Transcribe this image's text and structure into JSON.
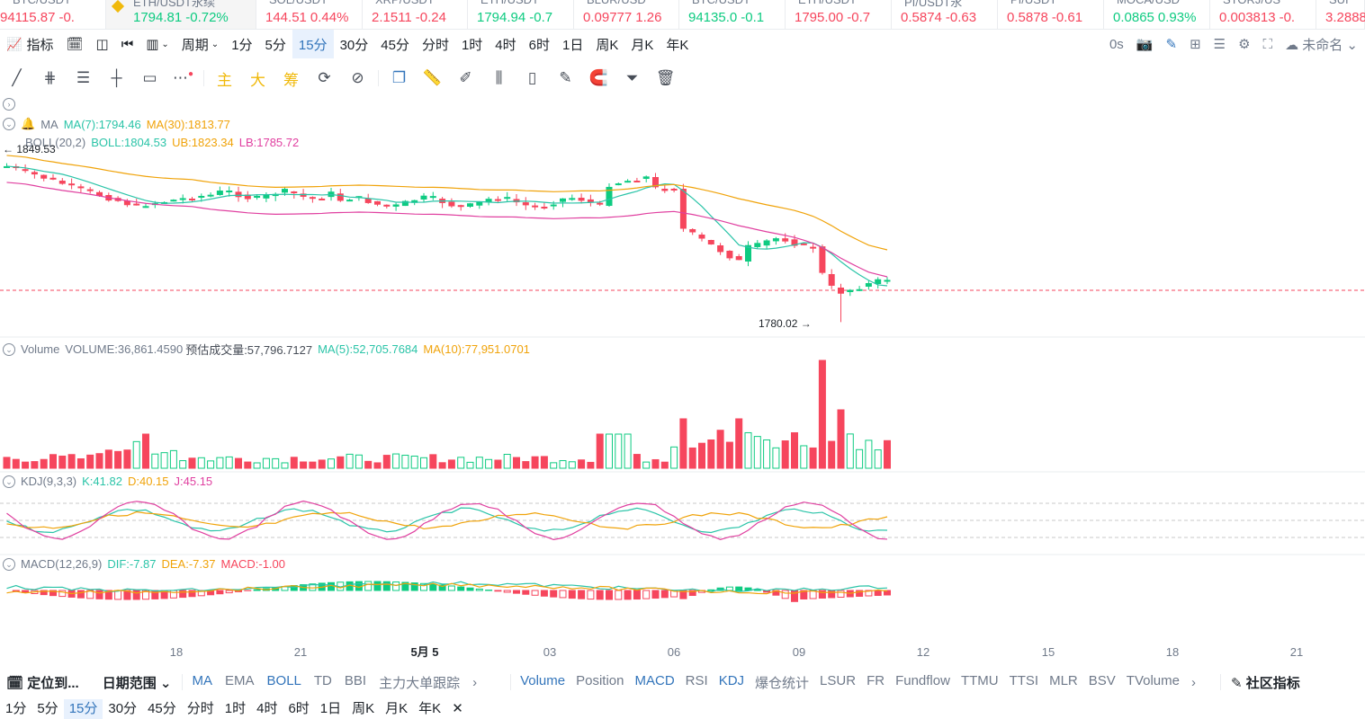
{
  "tickers": [
    {
      "symbol": "BTC/USDT",
      "price": "94115.87",
      "change": "-0.",
      "dir": "down",
      "active": false
    },
    {
      "symbol": "ETH/USDT永续",
      "price": "1794.81",
      "change": "-0.72%",
      "dir": "up",
      "active": true
    },
    {
      "symbol": "SOL/USDT",
      "price": "144.51",
      "change": "0.44%",
      "dir": "down",
      "active": false
    },
    {
      "symbol": "XRP/USDT",
      "price": "2.1511",
      "change": "-0.24",
      "dir": "down",
      "active": false
    },
    {
      "symbol": "ETH/USDT",
      "price": "1794.94",
      "change": "-0.7",
      "dir": "up",
      "active": false
    },
    {
      "symbol": "BLUR/USD",
      "price": "0.09777",
      "change": "1.26",
      "dir": "down",
      "active": false
    },
    {
      "symbol": "BTC/USDT",
      "price": "94135.0",
      "change": "-0.1",
      "dir": "up",
      "active": false
    },
    {
      "symbol": "ETH/USDT",
      "price": "1795.00",
      "change": "-0.7",
      "dir": "down",
      "active": false
    },
    {
      "symbol": "PI/USDT永",
      "price": "0.5874",
      "change": "-0.63",
      "dir": "down",
      "active": false
    },
    {
      "symbol": "PI/USDT",
      "price": "0.5878",
      "change": "-0.61",
      "dir": "down",
      "active": false
    },
    {
      "symbol": "MOCA/USD",
      "price": "0.0865",
      "change": "0.93%",
      "dir": "up",
      "active": false
    },
    {
      "symbol": "STORJ/US",
      "price": "0.003813",
      "change": "-0.",
      "dir": "down",
      "active": false
    },
    {
      "symbol": "SUI",
      "price": "3.2888",
      "change": "",
      "dir": "down",
      "active": false
    }
  ],
  "toolbar": {
    "indicator": "指标",
    "period": "周期",
    "intervals": [
      "1分",
      "5分",
      "15分",
      "30分",
      "45分",
      "分时",
      "1时",
      "4时",
      "6时",
      "1日",
      "周K",
      "月K",
      "年K"
    ],
    "active_interval": "15分",
    "countdown": "0s",
    "layout_name": "未命名"
  },
  "drawing_tools": {
    "main": "主",
    "big": "大",
    "chip": "筹"
  },
  "colors": {
    "up": "#0ecb81",
    "down": "#f6465d",
    "accent": "#3375bb",
    "ma7": "#2bc4a8",
    "ma30": "#f0a30a",
    "boll": "#e040a0",
    "lb": "#e040a0"
  },
  "ma_legend": {
    "name": "MA",
    "ma7": "MA(7):1794.46",
    "ma30": "MA(30):1813.77"
  },
  "boll_legend": {
    "name": "BOLL(20,2)",
    "boll": "BOLL:1804.53",
    "ub": "UB:1823.34",
    "lb": "LB:1785.72"
  },
  "high_marker": "1849.53",
  "low_marker": "1780.02",
  "volume_legend": {
    "name": "Volume",
    "volume": "VOLUME:36,861.4590",
    "est": "预估成交量:57,796.7127",
    "ma5": "MA(5):52,705.7684",
    "ma10": "MA(10):77,951.0701"
  },
  "kdj_legend": {
    "name": "KDJ(9,3,3)",
    "k": "K:41.82",
    "d": "D:40.15",
    "j": "J:45.15"
  },
  "macd_legend": {
    "name": "MACD(12,26,9)",
    "dif": "DIF:-7.87",
    "dea": "DEA:-7.37",
    "macd": "MACD:-1.00"
  },
  "x_axis": [
    "18",
    "21",
    "5月 5",
    "03",
    "06",
    "09",
    "12",
    "15",
    "18",
    "21"
  ],
  "bottom_bar": {
    "locate": "定位到...",
    "date_range": "日期范围",
    "main_indicators": [
      "MA",
      "EMA",
      "BOLL",
      "TD",
      "BBI",
      "主力大单跟踪"
    ],
    "sub_indicators": [
      "Volume",
      "Position",
      "MACD",
      "RSI",
      "KDJ",
      "爆仓统计",
      "LSUR",
      "FR",
      "Fundflow",
      "TTMU",
      "TTSI",
      "MLR",
      "BSV",
      "TVolume"
    ],
    "community": "社区指标"
  },
  "bottom_intervals": [
    "1分",
    "5分",
    "15分",
    "30分",
    "45分",
    "分时",
    "1时",
    "4时",
    "6时",
    "1日",
    "周K",
    "月K",
    "年K"
  ],
  "bottom_active": "15分"
}
